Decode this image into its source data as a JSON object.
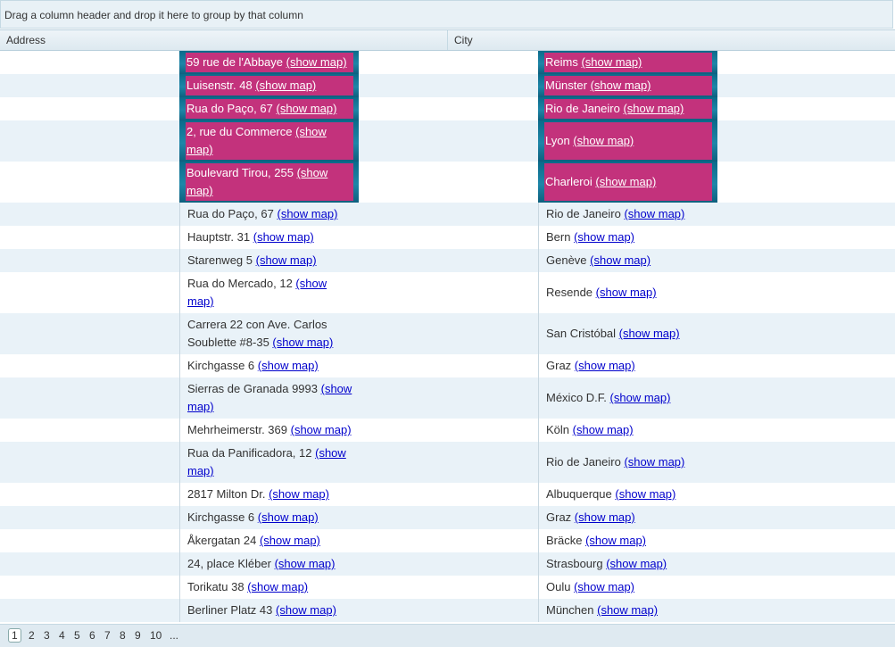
{
  "group_panel": {
    "hint": "Drag a column header and drop it here to group by that column"
  },
  "columns": {
    "address": "Address",
    "city": "City"
  },
  "link_label": "(show map)",
  "rows": [
    {
      "address": "59 rue de l'Abbaye",
      "city": "Reims",
      "selected": true,
      "lines": 1
    },
    {
      "address": "Luisenstr. 48",
      "city": "Münster",
      "selected": true,
      "lines": 1
    },
    {
      "address": "Rua do Paço, 67",
      "city": "Rio de Janeiro",
      "selected": true,
      "lines": 1
    },
    {
      "address": "2, rue du Commerce",
      "city": "Lyon",
      "selected": true,
      "lines": 2
    },
    {
      "address": "Boulevard Tirou, 255",
      "city": "Charleroi",
      "selected": true,
      "lines": 2
    },
    {
      "address": "Rua do Paço, 67",
      "city": "Rio de Janeiro",
      "lines": 1
    },
    {
      "address": "Hauptstr. 31",
      "city": "Bern",
      "lines": 1
    },
    {
      "address": "Starenweg 5",
      "city": "Genève",
      "lines": 1
    },
    {
      "address": "Rua do Mercado, 12",
      "city": "Resende",
      "lines": 2
    },
    {
      "address": "Carrera 22 con Ave. Carlos Soublette #8-35",
      "city": "San Cristóbal",
      "lines": 2
    },
    {
      "address": "Kirchgasse 6",
      "city": "Graz",
      "lines": 1
    },
    {
      "address": "Sierras de Granada 9993",
      "city": "México D.F.",
      "lines": 2
    },
    {
      "address": "Mehrheimerstr. 369",
      "city": "Köln",
      "lines": 1
    },
    {
      "address": "Rua da Panificadora, 12",
      "city": "Rio de Janeiro",
      "lines": 2
    },
    {
      "address": "2817 Milton Dr.",
      "city": "Albuquerque",
      "lines": 1
    },
    {
      "address": "Kirchgasse 6",
      "city": "Graz",
      "lines": 1
    },
    {
      "address": "Åkergatan 24",
      "city": "Bräcke",
      "lines": 1
    },
    {
      "address": "24, place Kléber",
      "city": "Strasbourg",
      "lines": 1
    },
    {
      "address": "Torikatu 38",
      "city": "Oulu",
      "lines": 1
    },
    {
      "address": "Berliner Platz 43",
      "city": "München",
      "lines": 1
    }
  ],
  "pager": {
    "pages": [
      "1",
      "2",
      "3",
      "4",
      "5",
      "6",
      "7",
      "8",
      "9",
      "10",
      "..."
    ],
    "current": "1"
  },
  "colors": {
    "selection_bg": "#0b6a8a",
    "selection_highlight": "#c3327c",
    "alt_row": "#e9f2f8",
    "link": "#0000cc"
  }
}
